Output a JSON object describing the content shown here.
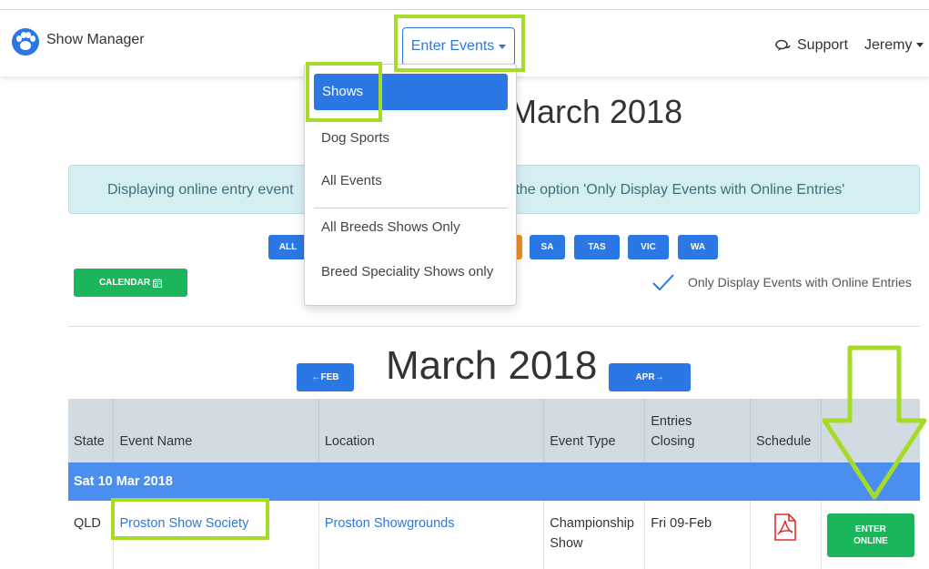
{
  "navbar": {
    "brand": "Show Manager",
    "events_dropdown": "Enter Events",
    "support": "Support",
    "user": "Jeremy"
  },
  "menu": {
    "items": [
      "Shows",
      "Dog Sports",
      "All Events",
      "All Breeds Shows Only",
      "Breed Speciality Shows only"
    ]
  },
  "page": {
    "top_title": "March 2018",
    "info_left": "Displaying online entry event",
    "info_right": "k the option 'Only Display Events with Online Entries'",
    "states": [
      "ALL",
      "SA",
      "TAS",
      "VIC",
      "WA"
    ],
    "calendar_btn": "CALENDAR",
    "only_online": "Only Display Events with Online Entries",
    "month_title": "March 2018",
    "prev_btn": "FEB",
    "next_btn": "APR"
  },
  "table": {
    "headers": {
      "state": "State",
      "event_name": "Event Name",
      "location": "Location",
      "event_type": "Event Type",
      "entries_closing_1": "Entries",
      "entries_closing_2": "Closing",
      "schedule": "Schedule"
    },
    "date_row": "Sat 10 Mar 2018",
    "row": {
      "state": "QLD",
      "event_name": "Proston Show Society",
      "location": "Proston Showgrounds",
      "event_type_1": "Championship",
      "event_type_2": "Show",
      "entries_closing": "Fri 09-Feb",
      "enter_1": "ENTER",
      "enter_2": "ONLINE"
    }
  },
  "colors": {
    "primary": "#2b78e4",
    "success": "#1bb55c",
    "highlight": "#a6db28",
    "info_bg": "#d5eef2",
    "orange": "#f08a24"
  }
}
